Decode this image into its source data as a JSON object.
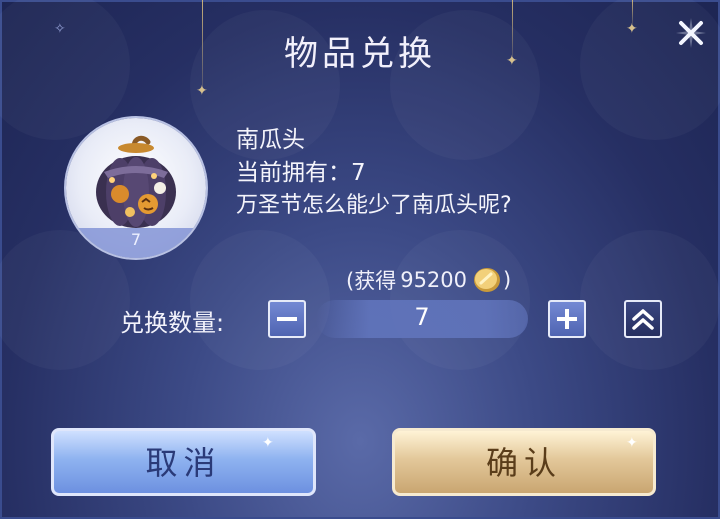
{
  "dialog": {
    "title": "物品兑换",
    "close_icon": "close-x-icon"
  },
  "item": {
    "name": "南瓜头",
    "owned": "当前拥有：7",
    "description": "万圣节怎么能少了南瓜头呢?",
    "badge_quantity": "7",
    "icon": "pumpkin-head-icon"
  },
  "exchange": {
    "gain_prefix": "(获得",
    "gain_amount": "95200",
    "gain_suffix": ")",
    "gain_icon": "gold-coin-icon",
    "quantity_label": "兑换数量:",
    "quantity_value": "7",
    "minus_icon": "minus-icon",
    "plus_icon": "plus-icon",
    "max_icon": "double-chevron-up-icon"
  },
  "buttons": {
    "cancel": "取消",
    "confirm": "确认"
  },
  "colors": {
    "background": "#262f63",
    "cancel_button": "#8fb3f0",
    "confirm_button": "#e3c89a",
    "text": "#f4f4fb"
  }
}
